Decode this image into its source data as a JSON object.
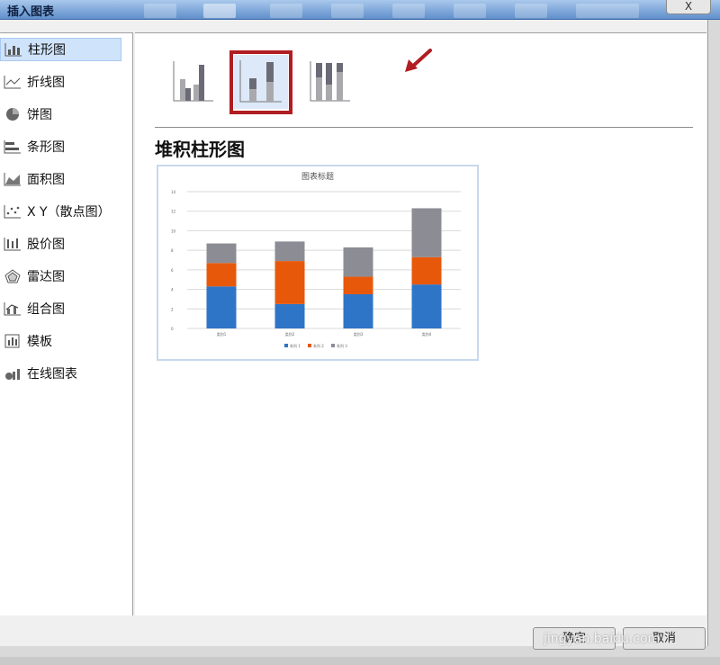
{
  "window": {
    "title": "插入图表",
    "close_label": "X"
  },
  "sidebar": {
    "items": [
      {
        "label": "柱形图",
        "icon": "column-chart-icon",
        "active": true
      },
      {
        "label": "折线图",
        "icon": "line-chart-icon"
      },
      {
        "label": "饼图",
        "icon": "pie-chart-icon"
      },
      {
        "label": "条形图",
        "icon": "bar-chart-icon"
      },
      {
        "label": "面积图",
        "icon": "area-chart-icon"
      },
      {
        "label": "X Y（散点图）",
        "icon": "scatter-chart-icon"
      },
      {
        "label": "股价图",
        "icon": "stock-chart-icon"
      },
      {
        "label": "雷达图",
        "icon": "radar-chart-icon"
      },
      {
        "label": "组合图",
        "icon": "combo-chart-icon"
      },
      {
        "label": "模板",
        "icon": "template-icon"
      },
      {
        "label": "在线图表",
        "icon": "online-chart-icon"
      }
    ]
  },
  "main": {
    "subtypes": [
      {
        "icon": "clustered-column-icon"
      },
      {
        "icon": "stacked-column-icon",
        "selected": true
      },
      {
        "icon": "percent-stacked-column-icon"
      }
    ],
    "type_title": "堆积柱形图"
  },
  "colors": {
    "series1": "#2e75c8",
    "series2": "#e8580b",
    "series3": "#8c8c95",
    "selection": "#b01d22",
    "arrow": "#b01d22"
  },
  "chart_data": {
    "type": "bar",
    "stacked": true,
    "title": "图表标题",
    "categories": [
      "类别1",
      "类别2",
      "类别3",
      "类别4"
    ],
    "series": [
      {
        "name": "系列 1",
        "values": [
          4.3,
          2.5,
          3.5,
          4.5
        ]
      },
      {
        "name": "系列 2",
        "values": [
          2.4,
          4.4,
          1.8,
          2.8
        ]
      },
      {
        "name": "系列 3",
        "values": [
          2.0,
          2.0,
          3.0,
          5.0
        ]
      }
    ],
    "ylim": [
      0,
      14
    ],
    "yticks": [
      "0",
      "2",
      "4",
      "6",
      "8",
      "10",
      "12",
      "14"
    ],
    "grid": true,
    "legend": "bottom"
  },
  "footer": {
    "ok_label": "确定",
    "cancel_label": "取消",
    "watermark": "jingyan.baidu.com"
  }
}
